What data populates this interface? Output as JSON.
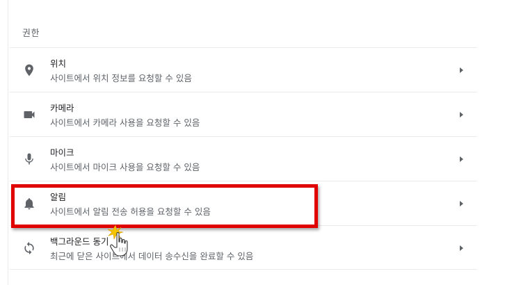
{
  "section": {
    "title": "권한"
  },
  "permissions": [
    {
      "icon": "location-pin-icon",
      "label": "위치",
      "description": "사이트에서 위치 정보를 요청할 수 있음"
    },
    {
      "icon": "camera-icon",
      "label": "카메라",
      "description": "사이트에서 카메라 사용을 요청할 수 있음"
    },
    {
      "icon": "microphone-icon",
      "label": "마이크",
      "description": "사이트에서 마이크 사용을 요청할 수 있음"
    },
    {
      "icon": "bell-icon",
      "label": "알림",
      "description": "사이트에서 알림 전송 허용을 요청할 수 있음"
    },
    {
      "icon": "sync-icon",
      "label": "백그라운드 동기",
      "description": "최근에 닫은 사이트에서 데이터 송수신을 완료할 수 있음"
    }
  ],
  "colors": {
    "highlight": "#e00000",
    "icon": "#5f6368",
    "divider": "#e8eaed"
  }
}
